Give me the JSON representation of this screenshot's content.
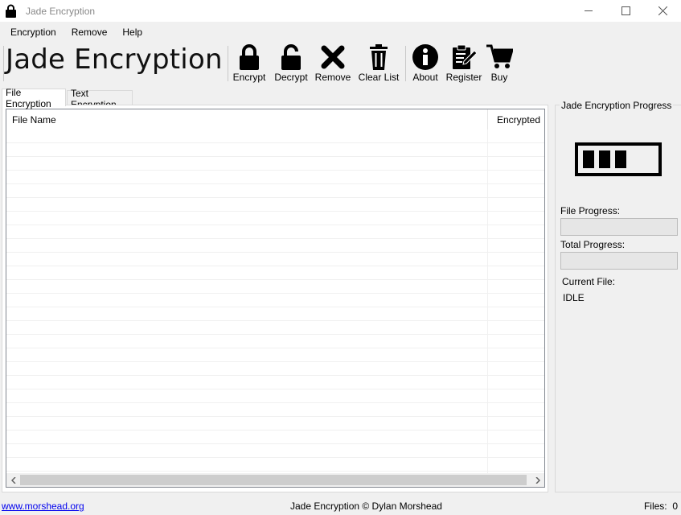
{
  "window": {
    "title": "Jade Encryption",
    "controls": {
      "minimize": "—",
      "maximize": "☐",
      "close": "✕"
    }
  },
  "menu": [
    "Encryption",
    "Remove",
    "Help"
  ],
  "brand": "Jade Encryption",
  "toolbar": [
    {
      "label": "Encrypt",
      "icon": "lock-closed-icon"
    },
    {
      "label": "Decrypt",
      "icon": "lock-open-icon"
    },
    {
      "label": "Remove",
      "icon": "x-icon"
    },
    {
      "label": "Clear List",
      "icon": "trash-icon"
    },
    {
      "label": "About",
      "icon": "info-icon"
    },
    {
      "label": "Register",
      "icon": "register-icon"
    },
    {
      "label": "Buy",
      "icon": "cart-icon"
    }
  ],
  "tabs": [
    {
      "label": "File Encryption",
      "active": true
    },
    {
      "label": "Text Encryption",
      "active": false
    }
  ],
  "list": {
    "columns": [
      "File Name",
      "Encrypted"
    ],
    "rows": []
  },
  "progress_group": {
    "title": "Jade Encryption Progress",
    "file_progress_label": "File Progress:",
    "file_progress": 0,
    "total_progress_label": "Total Progress:",
    "total_progress": 0,
    "current_file_label": "Current File:",
    "current_file": "IDLE"
  },
  "status": {
    "link": "www.morshead.org",
    "center": "Jade Encryption © Dylan Morshead",
    "files_label": "Files:",
    "files_count": "0"
  },
  "colors": {
    "link": "#0000ee",
    "icon": "#000000"
  }
}
